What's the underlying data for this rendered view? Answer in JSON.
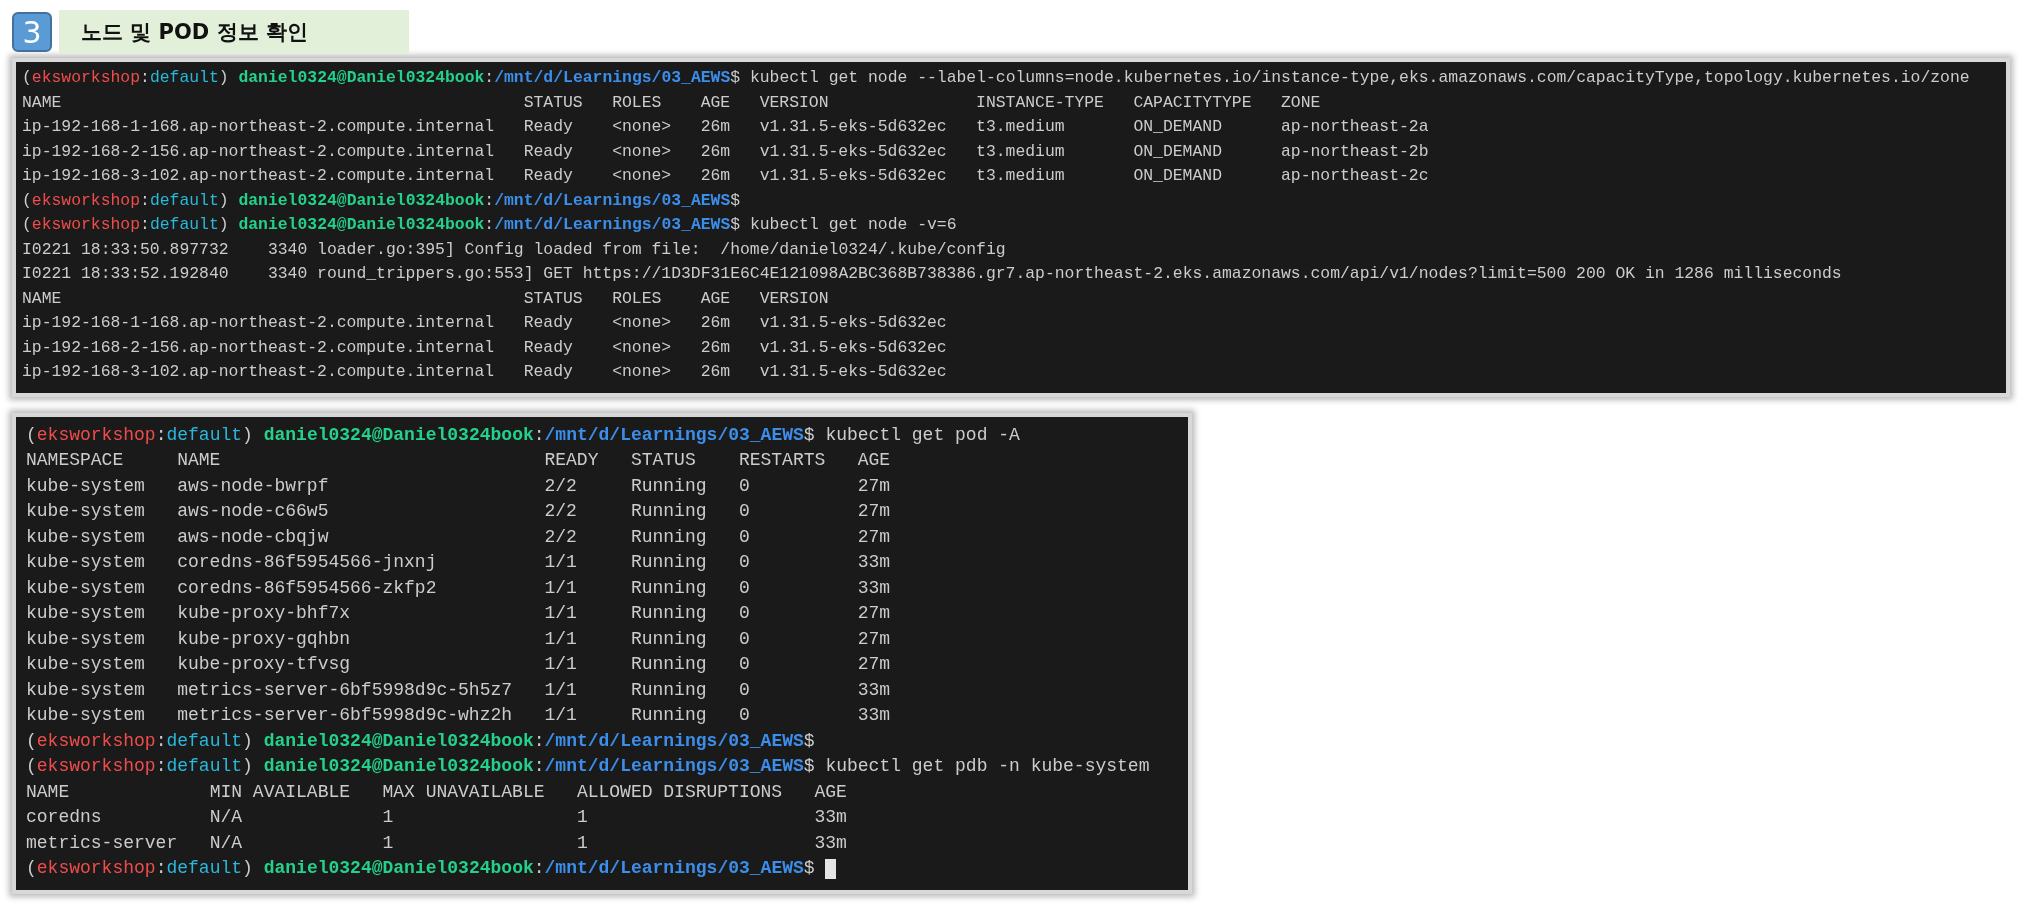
{
  "heading": {
    "badge": "3",
    "title": "노드 및 POD 정보 확인"
  },
  "terminals": [
    {
      "lines": [
        {
          "kind": "prompt",
          "cursor": false,
          "segments": [
            {
              "kind": "plain",
              "text": "("
            },
            {
              "kind": "env",
              "text": "eksworkshop"
            },
            {
              "kind": "plain",
              "text": ":"
            },
            {
              "kind": "context",
              "text": "default"
            },
            {
              "kind": "plain",
              "text": ") "
            },
            {
              "kind": "user",
              "text": "daniel0324@Daniel0324book"
            },
            {
              "kind": "plain",
              "text": ":"
            },
            {
              "kind": "path",
              "text": "/mnt/d/Learnings/03_AEWS"
            },
            {
              "kind": "plain",
              "text": "$ kubectl get node --label-columns=node.kubernetes.io/instance-type,eks.amazonaws.com/capacityType,topology.kubernetes.io/zone"
            }
          ]
        },
        {
          "kind": "table",
          "columns": [
            "NAME",
            "STATUS",
            "ROLES",
            "AGE",
            "VERSION",
            "INSTANCE-TYPE",
            "CAPACITYTYPE",
            "ZONE"
          ],
          "rows": [
            [
              "ip-192-168-1-168.ap-northeast-2.compute.internal",
              "Ready",
              "<none>",
              "26m",
              "v1.31.5-eks-5d632ec",
              "t3.medium",
              "ON_DEMAND",
              "ap-northeast-2a"
            ],
            [
              "ip-192-168-2-156.ap-northeast-2.compute.internal",
              "Ready",
              "<none>",
              "26m",
              "v1.31.5-eks-5d632ec",
              "t3.medium",
              "ON_DEMAND",
              "ap-northeast-2b"
            ],
            [
              "ip-192-168-3-102.ap-northeast-2.compute.internal",
              "Ready",
              "<none>",
              "26m",
              "v1.31.5-eks-5d632ec",
              "t3.medium",
              "ON_DEMAND",
              "ap-northeast-2c"
            ]
          ]
        },
        {
          "kind": "prompt",
          "cursor": false,
          "segments": [
            {
              "kind": "plain",
              "text": "("
            },
            {
              "kind": "env",
              "text": "eksworkshop"
            },
            {
              "kind": "plain",
              "text": ":"
            },
            {
              "kind": "context",
              "text": "default"
            },
            {
              "kind": "plain",
              "text": ") "
            },
            {
              "kind": "user",
              "text": "daniel0324@Daniel0324book"
            },
            {
              "kind": "plain",
              "text": ":"
            },
            {
              "kind": "path",
              "text": "/mnt/d/Learnings/03_AEWS"
            },
            {
              "kind": "plain",
              "text": "$"
            }
          ]
        },
        {
          "kind": "prompt",
          "cursor": false,
          "segments": [
            {
              "kind": "plain",
              "text": "("
            },
            {
              "kind": "env",
              "text": "eksworkshop"
            },
            {
              "kind": "plain",
              "text": ":"
            },
            {
              "kind": "context",
              "text": "default"
            },
            {
              "kind": "plain",
              "text": ") "
            },
            {
              "kind": "user",
              "text": "daniel0324@Daniel0324book"
            },
            {
              "kind": "plain",
              "text": ":"
            },
            {
              "kind": "path",
              "text": "/mnt/d/Learnings/03_AEWS"
            },
            {
              "kind": "plain",
              "text": "$ kubectl get node -v=6"
            }
          ]
        },
        {
          "kind": "output",
          "text": "I0221 18:33:50.897732    3340 loader.go:395] Config loaded from file:  /home/daniel0324/.kube/config"
        },
        {
          "kind": "output",
          "text": "I0221 18:33:52.192840    3340 round_trippers.go:553] GET https://1D3DF31E6C4E121098A2BC368B738386.gr7.ap-northeast-2.eks.amazonaws.com/api/v1/nodes?limit=500 200 OK in 1286 milliseconds"
        },
        {
          "kind": "table",
          "columns": [
            "NAME",
            "STATUS",
            "ROLES",
            "AGE",
            "VERSION"
          ],
          "rows": [
            [
              "ip-192-168-1-168.ap-northeast-2.compute.internal",
              "Ready",
              "<none>",
              "26m",
              "v1.31.5-eks-5d632ec"
            ],
            [
              "ip-192-168-2-156.ap-northeast-2.compute.internal",
              "Ready",
              "<none>",
              "26m",
              "v1.31.5-eks-5d632ec"
            ],
            [
              "ip-192-168-3-102.ap-northeast-2.compute.internal",
              "Ready",
              "<none>",
              "26m",
              "v1.31.5-eks-5d632ec"
            ]
          ]
        }
      ]
    },
    {
      "lines": [
        {
          "kind": "prompt",
          "cursor": false,
          "segments": [
            {
              "kind": "plain",
              "text": "("
            },
            {
              "kind": "env",
              "text": "eksworkshop"
            },
            {
              "kind": "plain",
              "text": ":"
            },
            {
              "kind": "context",
              "text": "default"
            },
            {
              "kind": "plain",
              "text": ") "
            },
            {
              "kind": "user",
              "text": "daniel0324@Daniel0324book"
            },
            {
              "kind": "plain",
              "text": ":"
            },
            {
              "kind": "path",
              "text": "/mnt/d/Learnings/03_AEWS"
            },
            {
              "kind": "plain",
              "text": "$ kubectl get pod -A"
            }
          ]
        },
        {
          "kind": "table",
          "columns": [
            "NAMESPACE",
            "NAME",
            "READY",
            "STATUS",
            "RESTARTS",
            "AGE"
          ],
          "rows": [
            [
              "kube-system",
              "aws-node-bwrpf",
              "2/2",
              "Running",
              "0",
              "27m"
            ],
            [
              "kube-system",
              "aws-node-c66w5",
              "2/2",
              "Running",
              "0",
              "27m"
            ],
            [
              "kube-system",
              "aws-node-cbqjw",
              "2/2",
              "Running",
              "0",
              "27m"
            ],
            [
              "kube-system",
              "coredns-86f5954566-jnxnj",
              "1/1",
              "Running",
              "0",
              "33m"
            ],
            [
              "kube-system",
              "coredns-86f5954566-zkfp2",
              "1/1",
              "Running",
              "0",
              "33m"
            ],
            [
              "kube-system",
              "kube-proxy-bhf7x",
              "1/1",
              "Running",
              "0",
              "27m"
            ],
            [
              "kube-system",
              "kube-proxy-gqhbn",
              "1/1",
              "Running",
              "0",
              "27m"
            ],
            [
              "kube-system",
              "kube-proxy-tfvsg",
              "1/1",
              "Running",
              "0",
              "27m"
            ],
            [
              "kube-system",
              "metrics-server-6bf5998d9c-5h5z7",
              "1/1",
              "Running",
              "0",
              "33m"
            ],
            [
              "kube-system",
              "metrics-server-6bf5998d9c-whz2h",
              "1/1",
              "Running",
              "0",
              "33m"
            ]
          ]
        },
        {
          "kind": "prompt",
          "cursor": false,
          "segments": [
            {
              "kind": "plain",
              "text": "("
            },
            {
              "kind": "env",
              "text": "eksworkshop"
            },
            {
              "kind": "plain",
              "text": ":"
            },
            {
              "kind": "context",
              "text": "default"
            },
            {
              "kind": "plain",
              "text": ") "
            },
            {
              "kind": "user",
              "text": "daniel0324@Daniel0324book"
            },
            {
              "kind": "plain",
              "text": ":"
            },
            {
              "kind": "path",
              "text": "/mnt/d/Learnings/03_AEWS"
            },
            {
              "kind": "plain",
              "text": "$"
            }
          ]
        },
        {
          "kind": "prompt",
          "cursor": false,
          "segments": [
            {
              "kind": "plain",
              "text": "("
            },
            {
              "kind": "env",
              "text": "eksworkshop"
            },
            {
              "kind": "plain",
              "text": ":"
            },
            {
              "kind": "context",
              "text": "default"
            },
            {
              "kind": "plain",
              "text": ") "
            },
            {
              "kind": "user",
              "text": "daniel0324@Daniel0324book"
            },
            {
              "kind": "plain",
              "text": ":"
            },
            {
              "kind": "path",
              "text": "/mnt/d/Learnings/03_AEWS"
            },
            {
              "kind": "plain",
              "text": "$ kubectl get pdb -n kube-system"
            }
          ]
        },
        {
          "kind": "table",
          "columns": [
            "NAME",
            "MIN AVAILABLE",
            "MAX UNAVAILABLE",
            "ALLOWED DISRUPTIONS",
            "AGE"
          ],
          "rows": [
            [
              "coredns",
              "N/A",
              "1",
              "1",
              "33m"
            ],
            [
              "metrics-server",
              "N/A",
              "1",
              "1",
              "33m"
            ]
          ]
        },
        {
          "kind": "prompt",
          "cursor": true,
          "segments": [
            {
              "kind": "plain",
              "text": "("
            },
            {
              "kind": "env",
              "text": "eksworkshop"
            },
            {
              "kind": "plain",
              "text": ":"
            },
            {
              "kind": "context",
              "text": "default"
            },
            {
              "kind": "plain",
              "text": ") "
            },
            {
              "kind": "user",
              "text": "daniel0324@Daniel0324book"
            },
            {
              "kind": "plain",
              "text": ":"
            },
            {
              "kind": "path",
              "text": "/mnt/d/Learnings/03_AEWS"
            },
            {
              "kind": "plain",
              "text": "$ "
            }
          ]
        }
      ]
    }
  ]
}
